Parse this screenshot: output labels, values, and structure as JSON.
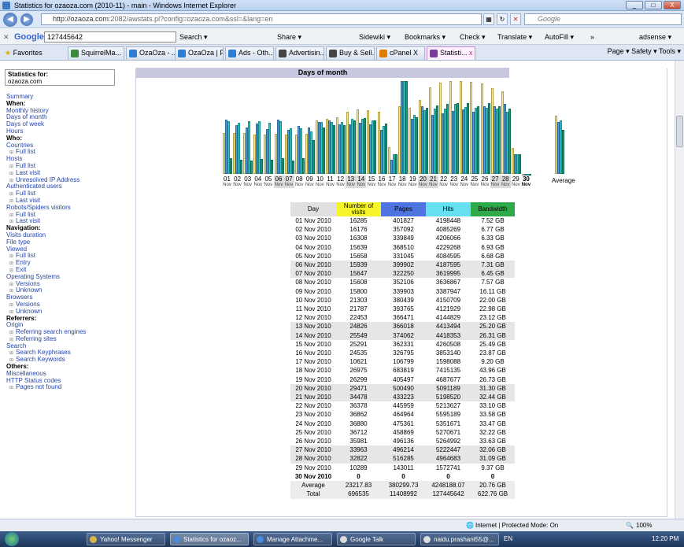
{
  "window": {
    "title": "Statistics for ozaoza.com (2010-11) - main - Windows Internet Explorer",
    "controls": [
      "_",
      "□",
      "X"
    ]
  },
  "address": {
    "url_main": "http://ozaoza.com",
    "url_rest": ":2082/awstats.pl?config=ozaoza.com&ssl=&lang=en",
    "search_placeholder": "Google"
  },
  "google_toolbar": {
    "logo": "Google",
    "query": "127445642",
    "search": "Search ▾",
    "share": "Share ▾",
    "sidewiki": "Sidewiki ▾",
    "bookmarks": "Bookmarks ▾",
    "check": "Check ▾",
    "translate": "Translate ▾",
    "autofill": "AutoFill ▾",
    "more": "»",
    "account": "adsense ▾"
  },
  "favorites": {
    "label": "Favorites",
    "tabs": [
      "SquirrelMa...",
      "OzaOza - ...",
      "OzaOza | F...",
      "Ads - Oth...",
      "Advertisin...",
      "Buy & Sell...",
      "cPanel X",
      "Statisti..."
    ],
    "tab_close": "x",
    "commands": "Page ▾  Safety ▾  Tools ▾"
  },
  "sidebar": {
    "stats_for_label": "Statistics for:",
    "stats_for_value": "ozaoza.com",
    "items": [
      {
        "t": "l",
        "text": "Summary"
      },
      {
        "t": "h",
        "text": "When:"
      },
      {
        "t": "l",
        "text": "Monthly history"
      },
      {
        "t": "l",
        "text": "Days of month"
      },
      {
        "t": "l",
        "text": "Days of week"
      },
      {
        "t": "l",
        "text": "Hours"
      },
      {
        "t": "h",
        "text": "Who:"
      },
      {
        "t": "l",
        "text": "Countries"
      },
      {
        "t": "s",
        "text": "Full list"
      },
      {
        "t": "l",
        "text": "Hosts"
      },
      {
        "t": "s",
        "text": "Full list"
      },
      {
        "t": "s",
        "text": "Last visit"
      },
      {
        "t": "s",
        "text": "Unresolved IP Address"
      },
      {
        "t": "l",
        "text": "Authenticated users"
      },
      {
        "t": "s",
        "text": "Full list"
      },
      {
        "t": "s",
        "text": "Last visit"
      },
      {
        "t": "l",
        "text": "Robots/Spiders visitors"
      },
      {
        "t": "s",
        "text": "Full list"
      },
      {
        "t": "s",
        "text": "Last visit"
      },
      {
        "t": "h",
        "text": "Navigation:"
      },
      {
        "t": "l",
        "text": "Visits duration"
      },
      {
        "t": "l",
        "text": "File type"
      },
      {
        "t": "l",
        "text": "Viewed"
      },
      {
        "t": "s",
        "text": "Full list"
      },
      {
        "t": "s",
        "text": "Entry"
      },
      {
        "t": "s",
        "text": "Exit"
      },
      {
        "t": "l",
        "text": "Operating Systems"
      },
      {
        "t": "s",
        "text": "Versions"
      },
      {
        "t": "s",
        "text": "Unknown"
      },
      {
        "t": "l",
        "text": "Browsers"
      },
      {
        "t": "s",
        "text": "Versions"
      },
      {
        "t": "s",
        "text": "Unknown"
      },
      {
        "t": "h",
        "text": "Referrers:"
      },
      {
        "t": "l",
        "text": "Origin"
      },
      {
        "t": "s",
        "text": "Referring search engines"
      },
      {
        "t": "s",
        "text": "Referring sites"
      },
      {
        "t": "l",
        "text": "Search"
      },
      {
        "t": "s",
        "text": "Search Keyphrases"
      },
      {
        "t": "s",
        "text": "Search Keywords"
      },
      {
        "t": "h",
        "text": "Others:"
      },
      {
        "t": "l",
        "text": "Miscellaneous"
      },
      {
        "t": "l",
        "text": "HTTP Status codes"
      },
      {
        "t": "s",
        "text": "Pages not found"
      }
    ]
  },
  "section_title": "Days of month",
  "colors": {
    "visits": "#f5e6a0",
    "pages": "#4d9ed4",
    "hits": "#39c8c8",
    "bandwidth": "#1aa07c"
  },
  "table": {
    "headers": [
      "Day",
      "Number of visits",
      "Pages",
      "Hits",
      "Bandwidth"
    ],
    "header_colors": [
      "#e0e0e0",
      "#f5f52a",
      "#4d74e0",
      "#66e0f0",
      "#2eaa4a"
    ],
    "rows": [
      [
        "01 Nov 2010",
        "16285",
        "401827",
        "4198448",
        "7.52 GB"
      ],
      [
        "02 Nov 2010",
        "16176",
        "357092",
        "4085269",
        "6.77 GB"
      ],
      [
        "03 Nov 2010",
        "16308",
        "339849",
        "4206066",
        "6.33 GB"
      ],
      [
        "04 Nov 2010",
        "15639",
        "368510",
        "4229268",
        "6.93 GB"
      ],
      [
        "05 Nov 2010",
        "15658",
        "331045",
        "4084595",
        "6.68 GB"
      ],
      [
        "06 Nov 2010",
        "15939",
        "399902",
        "4187595",
        "7.31 GB"
      ],
      [
        "07 Nov 2010",
        "15647",
        "322250",
        "3619995",
        "6.45 GB"
      ],
      [
        "08 Nov 2010",
        "15608",
        "352106",
        "3636867",
        "7.57 GB"
      ],
      [
        "09 Nov 2010",
        "15800",
        "339903",
        "3387947",
        "16.11 GB"
      ],
      [
        "10 Nov 2010",
        "21303",
        "380439",
        "4150709",
        "22.00 GB"
      ],
      [
        "11 Nov 2010",
        "21787",
        "393765",
        "4121929",
        "22.98 GB"
      ],
      [
        "12 Nov 2010",
        "22453",
        "366471",
        "4144829",
        "23.12 GB"
      ],
      [
        "13 Nov 2010",
        "24826",
        "366018",
        "4413494",
        "25.20 GB"
      ],
      [
        "14 Nov 2010",
        "25549",
        "374062",
        "4418353",
        "26.31 GB"
      ],
      [
        "15 Nov 2010",
        "25291",
        "362331",
        "4260508",
        "25.49 GB"
      ],
      [
        "16 Nov 2010",
        "24535",
        "326795",
        "3853140",
        "23.87 GB"
      ],
      [
        "17 Nov 2010",
        "10621",
        "106799",
        "1598088",
        "9.20 GB"
      ],
      [
        "18 Nov 2010",
        "26975",
        "683819",
        "7415135",
        "43.96 GB"
      ],
      [
        "19 Nov 2010",
        "26299",
        "405497",
        "4687677",
        "26.73 GB"
      ],
      [
        "20 Nov 2010",
        "29471",
        "500490",
        "5091189",
        "31.30 GB"
      ],
      [
        "21 Nov 2010",
        "34478",
        "433223",
        "5198520",
        "32.44 GB"
      ],
      [
        "22 Nov 2010",
        "36378",
        "445959",
        "5213627",
        "33.10 GB"
      ],
      [
        "23 Nov 2010",
        "36862",
        "464964",
        "5595189",
        "33.58 GB"
      ],
      [
        "24 Nov 2010",
        "36880",
        "475361",
        "5351671",
        "33.47 GB"
      ],
      [
        "25 Nov 2010",
        "36712",
        "458869",
        "5270671",
        "32.22 GB"
      ],
      [
        "26 Nov 2010",
        "35981",
        "496136",
        "5264992",
        "33.63 GB"
      ],
      [
        "27 Nov 2010",
        "33963",
        "496214",
        "5222447",
        "32.06 GB"
      ],
      [
        "28 Nov 2010",
        "32822",
        "516285",
        "4964683",
        "31.09 GB"
      ],
      [
        "29 Nov 2010",
        "10289",
        "143011",
        "1572741",
        "9.37 GB"
      ],
      [
        "30 Nov 2010",
        "0",
        "0",
        "0",
        "0"
      ]
    ],
    "weekend_rows": [
      5,
      6,
      12,
      13,
      19,
      20,
      26,
      27
    ],
    "today_row": 29,
    "average": [
      "Average",
      "23217.83",
      "380299.73",
      "4248188.07",
      "20.76 GB"
    ],
    "total": [
      "Total",
      "696535",
      "11408992",
      "127445642",
      "622.76 GB"
    ]
  },
  "chart_data": {
    "type": "bar",
    "categories": [
      "01",
      "02",
      "03",
      "04",
      "05",
      "06",
      "07",
      "08",
      "09",
      "10",
      "11",
      "12",
      "13",
      "14",
      "15",
      "16",
      "17",
      "18",
      "19",
      "20",
      "21",
      "22",
      "23",
      "24",
      "25",
      "26",
      "27",
      "28",
      "29",
      "30"
    ],
    "category_sublabel": "Nov",
    "weekend_index": [
      5,
      6,
      12,
      13,
      19,
      20,
      26,
      27
    ],
    "today_index": 29,
    "series": [
      {
        "name": "Number of visits",
        "values": [
          16285,
          16176,
          16308,
          15639,
          15658,
          15939,
          15647,
          15608,
          15800,
          21303,
          21787,
          22453,
          24826,
          25549,
          25291,
          24535,
          10621,
          26975,
          26299,
          29471,
          34478,
          36378,
          36862,
          36880,
          36712,
          35981,
          33963,
          32822,
          10289,
          0
        ]
      },
      {
        "name": "Pages",
        "values": [
          401827,
          357092,
          339849,
          368510,
          331045,
          399902,
          322250,
          352106,
          339903,
          380439,
          393765,
          366471,
          366018,
          374062,
          362331,
          326795,
          106799,
          683819,
          405497,
          500490,
          433223,
          445959,
          464964,
          475361,
          458869,
          496136,
          496214,
          516285,
          143011,
          0
        ]
      },
      {
        "name": "Hits",
        "values": [
          4198448,
          4085269,
          4206066,
          4229268,
          4084595,
          4187595,
          3619995,
          3636867,
          3387947,
          4150709,
          4121929,
          4144829,
          4413494,
          4418353,
          4260508,
          3853140,
          1598088,
          7415135,
          4687677,
          5091189,
          5198520,
          5213627,
          5595189,
          5351671,
          5270671,
          5264992,
          5222447,
          4964683,
          1572741,
          0
        ]
      },
      {
        "name": "Bandwidth",
        "unit": "GB",
        "values": [
          7.52,
          6.77,
          6.33,
          6.93,
          6.68,
          7.31,
          6.45,
          7.57,
          16.11,
          22.0,
          22.98,
          23.12,
          25.2,
          26.31,
          25.49,
          23.87,
          9.2,
          43.96,
          26.73,
          31.3,
          32.44,
          33.1,
          33.58,
          33.47,
          32.22,
          33.63,
          32.06,
          31.09,
          9.37,
          0
        ]
      }
    ],
    "average": {
      "label": "Average",
      "values": [
        23217.83,
        380299.73,
        4248188.07,
        20.76
      ]
    }
  },
  "status": {
    "zone": "Internet | Protected Mode: On",
    "zoom": "100%"
  },
  "taskbar": {
    "items": [
      "Yahoo! Messenger",
      "Statistics for ozaoz...",
      "Manage Attachme...",
      "Google Talk",
      "naidu.prashant55@..."
    ],
    "lang": "EN",
    "clock": "12:20 PM"
  }
}
